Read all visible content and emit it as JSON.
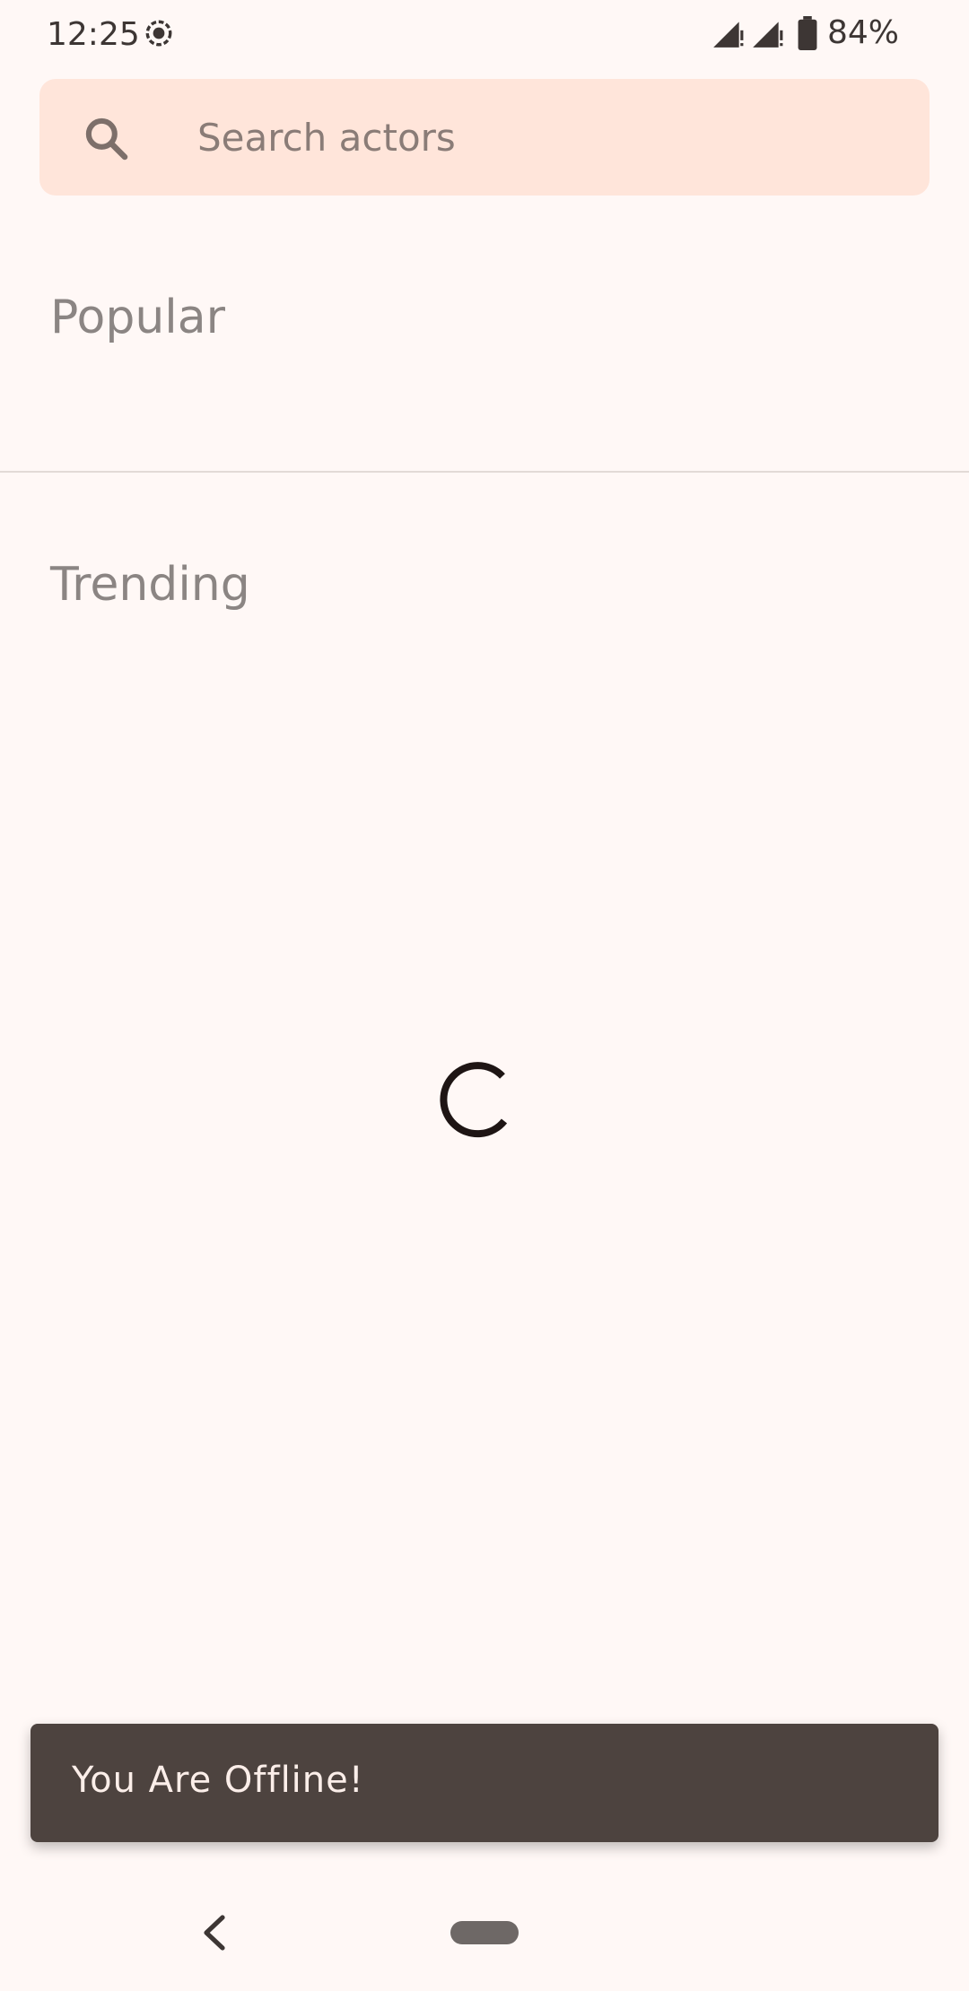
{
  "status_bar": {
    "time": "12:25",
    "battery": "84%"
  },
  "search": {
    "placeholder": "Search actors",
    "value": ""
  },
  "sections": {
    "popular": "Popular",
    "trending": "Trending"
  },
  "snackbar": {
    "message": "You Are Offline!"
  },
  "icons": {
    "status": [
      "screen-record-icon",
      "signal-icon",
      "signal-icon",
      "battery-icon"
    ],
    "search": "search-icon",
    "loading": "loading-spinner",
    "nav": [
      "back-icon",
      "home-pill"
    ]
  },
  "colors": {
    "background": "#fff8f6",
    "search_bar": "#ffe5da",
    "snackbar": "#4d433f",
    "section_title": "#8b8583"
  }
}
